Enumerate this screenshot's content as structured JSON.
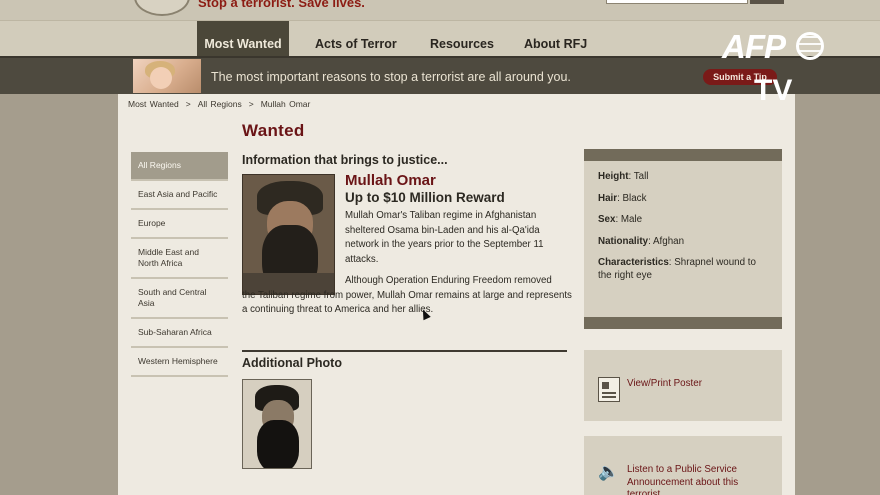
{
  "header": {
    "tagline": "Stop a terrorist. Save lives."
  },
  "nav": {
    "items": [
      "Most Wanted",
      "Acts of Terror",
      "Resources",
      "About RFJ"
    ],
    "active": "Most Wanted"
  },
  "banner": {
    "text": "The most important reasons to stop a terrorist are all around you.",
    "submit_tip": "Submit a Tip"
  },
  "watermark": {
    "brand": "AFP",
    "sub": "TV"
  },
  "breadcrumb": [
    "Most Wanted",
    "All Regions",
    "Mullah Omar"
  ],
  "breadcrumb_sep": ">",
  "page_title": "Wanted",
  "regions": [
    "All Regions",
    "East Asia and Pacific",
    "Europe",
    "Middle East and North Africa",
    "South and Central Asia",
    "Sub-Saharan Africa",
    "Western Hemisphere"
  ],
  "profile": {
    "heading": "Information that brings to justice...",
    "name": "Mullah Omar",
    "reward": "Up to $10 Million Reward",
    "bio_1": "Mullah Omar's Taliban regime in Afghanistan sheltered Osama bin-Laden and his al-Qa'ida network in the years prior to the September 11 attacks.",
    "bio_2_first": "Although Operation Enduring Freedom removed",
    "bio_2_rest": "the Taliban regime from power, Mullah Omar remains at large and represents a continuing threat to America and her allies.",
    "additional_photo_heading": "Additional Photo"
  },
  "facts": [
    {
      "key": "Height",
      "value": "Tall"
    },
    {
      "key": "Hair",
      "value": "Black"
    },
    {
      "key": "Sex",
      "value": "Male"
    },
    {
      "key": "Nationality",
      "value": "Afghan"
    },
    {
      "key": "Characteristics",
      "value": "Shrapnel wound to the right eye"
    }
  ],
  "actions": {
    "poster": "View/Print Poster",
    "psa": "Listen to a Public Service Announcement about this terrorist"
  },
  "icons": [
    "seal-icon",
    "poster-icon",
    "speaker-icon",
    "globe-icon",
    "cursor-icon"
  ]
}
